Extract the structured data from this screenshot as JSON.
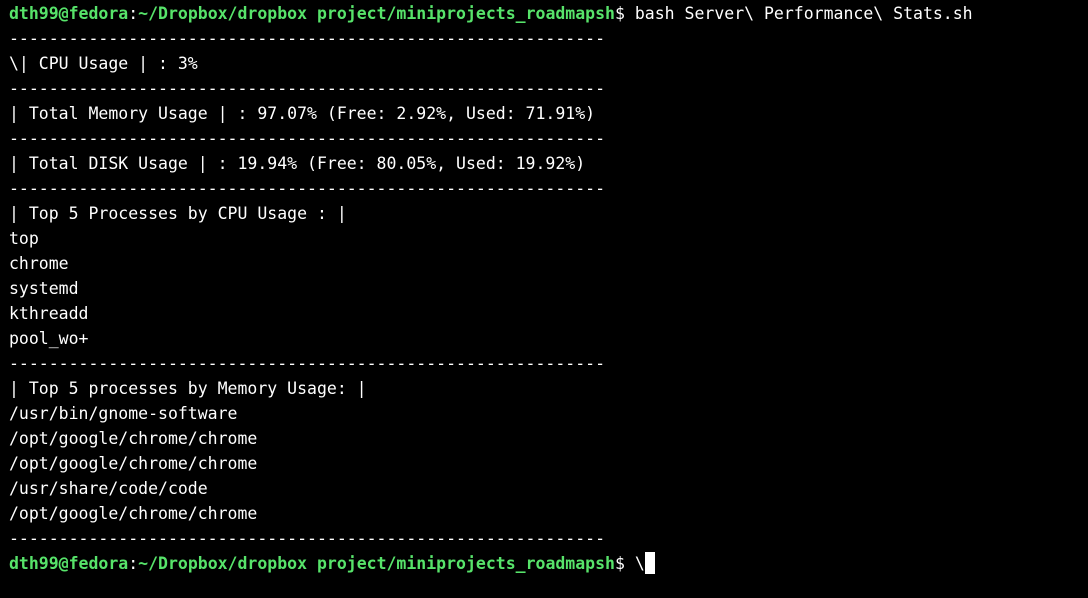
{
  "colors": {
    "background": "#000000",
    "text": "#ffffff",
    "prompt": "#57e36a"
  },
  "prompt": {
    "user_host": "dth99@fedora",
    "colon": ":",
    "path": "~/Dropbox/dropbox project/miniprojects_roadmapsh",
    "symbol": "$ "
  },
  "command": "bash Server\\ Performance\\ Stats.sh",
  "separator": "------------------------------------------------------------",
  "cpu_line": "\\| CPU Usage | : 3%",
  "memory_line": "| Total Memory Usage | : 97.07% (Free: 2.92%, Used: 71.91%)",
  "disk_line": "| Total DISK Usage | : 19.94% (Free: 80.05%, Used: 19.92%)",
  "top_cpu": {
    "header": "| Top 5 Processes by CPU Usage : |",
    "items": [
      "top",
      "chrome",
      "systemd",
      "kthreadd",
      "pool_wo+"
    ]
  },
  "top_mem": {
    "header": "| Top 5 processes by Memory Usage: |",
    "items": [
      "/usr/bin/gnome-software",
      "/opt/google/chrome/chrome",
      "/opt/google/chrome/chrome",
      "/usr/share/code/code",
      "/opt/google/chrome/chrome"
    ]
  },
  "current_input": "\\"
}
